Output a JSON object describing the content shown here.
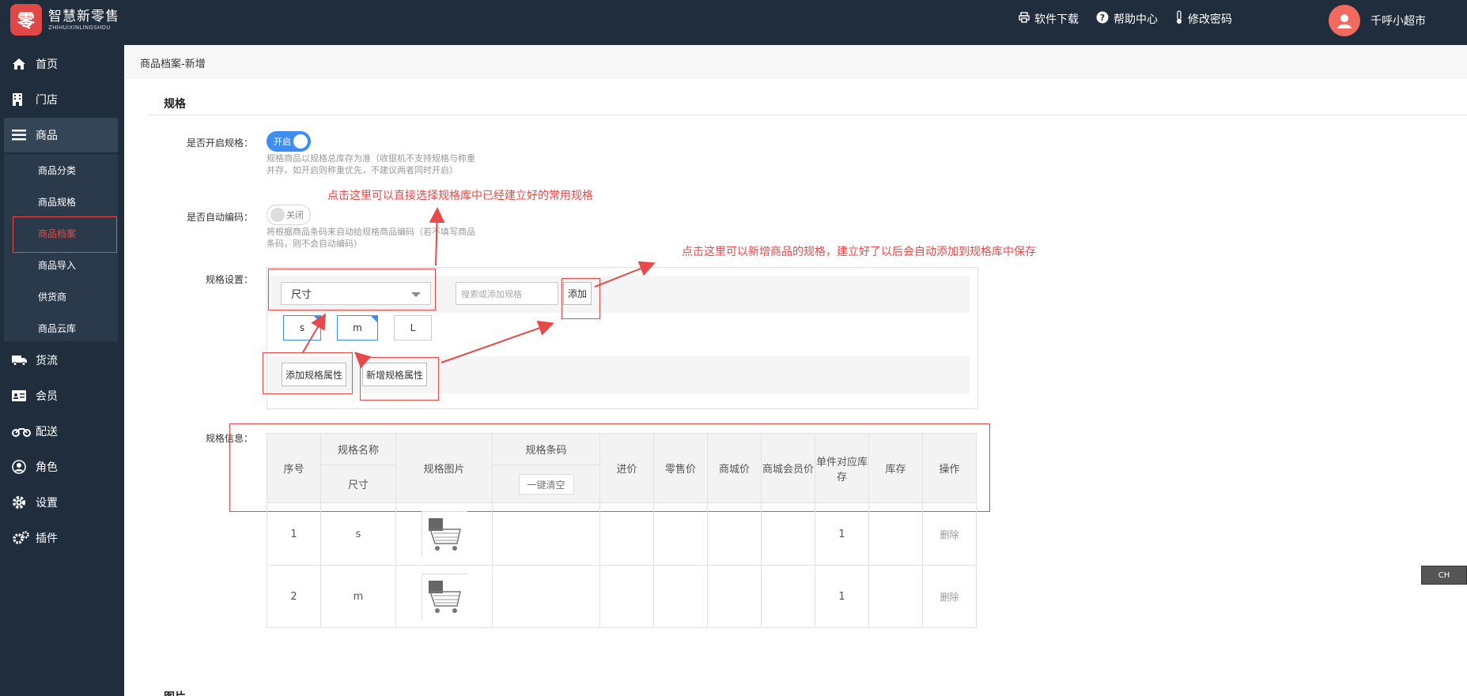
{
  "brand": {
    "mark": "零",
    "name_cn": "智慧新零售",
    "name_en": "ZHIHUIXINLINGSHOU"
  },
  "header": {
    "links": [
      {
        "label": "软件下载",
        "icon": "printer-icon"
      },
      {
        "label": "帮助中心",
        "icon": "help-icon"
      },
      {
        "label": "修改密码",
        "icon": "thermometer-icon"
      }
    ],
    "user_name": "千呼小超市"
  },
  "sidebar": {
    "items": [
      {
        "label": "首页",
        "icon": "home-icon"
      },
      {
        "label": "门店",
        "icon": "building-icon"
      },
      {
        "label": "商品",
        "icon": "menu-icon"
      },
      {
        "label": "货流",
        "icon": "truck-icon"
      },
      {
        "label": "会员",
        "icon": "id-card-icon"
      },
      {
        "label": "配送",
        "icon": "motorcycle-icon"
      },
      {
        "label": "角色",
        "icon": "user-circle-icon"
      },
      {
        "label": "设置",
        "icon": "gear-icon"
      },
      {
        "label": "插件",
        "icon": "gears-icon"
      }
    ],
    "submenu": [
      "商品分类",
      "商品规格",
      "商品档案",
      "商品导入",
      "供货商",
      "商品云库"
    ]
  },
  "breadcrumb": "商品档案-新增",
  "section": {
    "title": "规格",
    "next_title": "图片"
  },
  "form": {
    "enable_spec_label": "是否开启规格：",
    "enable_spec_state": "开启",
    "enable_spec_hint": "规格商品以规格总库存为准（收银机不支持规格与称重并存，如开启则称重优先，不建议两者同时开启）",
    "auto_code_label": "是否自动编码：",
    "auto_code_state": "关闭",
    "auto_code_hint": "将根据商品条码来自动给规格商品编码（若不填写商品条码，则不会自动编码）",
    "spec_settings_label": "规格设置：",
    "spec_select_value": "尺寸",
    "spec_search_placeholder": "搜索或添加规格",
    "add_button": "添加",
    "tags": [
      "s",
      "m",
      "L"
    ],
    "add_attr_button": "添加规格属性",
    "new_attr_button": "新增规格属性",
    "spec_info_label": "规格信息："
  },
  "annotations": {
    "select_tip": "点击这里可以直接选择规格库中已经建立好的常用规格",
    "add_tip": "点击这里可以新增商品的规格，建立好了以后会自动添加到规格库中保存"
  },
  "table": {
    "headers": {
      "index": "序号",
      "spec_name": "规格名称",
      "spec_name_sub": "尺寸",
      "spec_image": "规格图片",
      "spec_barcode": "规格条码",
      "clear_button": "一键清空",
      "purchase_price": "进价",
      "retail_price": "零售价",
      "mall_price": "商城价",
      "mall_member_price": "商城会员价",
      "unit_stock": "单件对应库存",
      "stock": "库存",
      "action": "操作"
    },
    "rows": [
      {
        "index": "1",
        "name": "s",
        "unit_stock": "1",
        "action": "删除"
      },
      {
        "index": "2",
        "name": "m",
        "unit_stock": "1",
        "action": "删除"
      }
    ]
  },
  "ime": "CH",
  "colors": {
    "nav_bg": "#1f2d3d",
    "accent": "#3d8ef0",
    "annotation": "#e84a4a"
  }
}
